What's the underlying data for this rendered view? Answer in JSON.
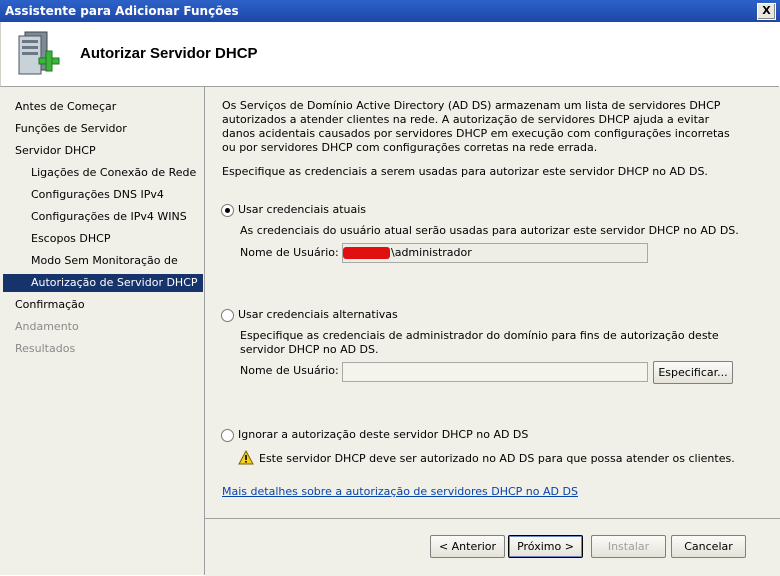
{
  "window": {
    "title": "Assistente para Adicionar Funções",
    "close_glyph": "X"
  },
  "header": {
    "title": "Autorizar Servidor DHCP",
    "icon": "server-add-icon"
  },
  "nav": {
    "items": [
      {
        "label": "Antes de Começar",
        "level": 0,
        "state": "normal"
      },
      {
        "label": "Funções de Servidor",
        "level": 0,
        "state": "normal"
      },
      {
        "label": "Servidor DHCP",
        "level": 0,
        "state": "normal"
      },
      {
        "label": "Ligações de Conexão de Rede",
        "level": 1,
        "state": "normal"
      },
      {
        "label": "Configurações DNS IPv4",
        "level": 1,
        "state": "normal"
      },
      {
        "label": "Configurações de IPv4 WINS",
        "level": 1,
        "state": "normal"
      },
      {
        "label": "Escopos DHCP",
        "level": 1,
        "state": "normal"
      },
      {
        "label": "Modo Sem Monitoração de Est...",
        "level": 1,
        "state": "normal"
      },
      {
        "label": "Autorização de Servidor DHCP",
        "level": 1,
        "state": "active"
      },
      {
        "label": "Confirmação",
        "level": 0,
        "state": "normal"
      },
      {
        "label": "Andamento",
        "level": 0,
        "state": "disabled"
      },
      {
        "label": "Resultados",
        "level": 0,
        "state": "disabled"
      }
    ]
  },
  "main": {
    "intro": "Os Serviços de Domínio Active Directory (AD DS) armazenam um lista de servidores DHCP autorizados a atender clientes na rede. A autorização de servidores DHCP ajuda a evitar danos acidentais causados por servidores DHCP em execução com configurações incorretas ou por servidores DHCP com configurações corretas na rede errada.",
    "instruction": "Especifique as credenciais a serem usadas para autorizar este servidor DHCP no AD DS.",
    "opt_current": {
      "label": "Usar credenciais atuais",
      "desc": "As credenciais do usuário atual serão usadas para autorizar este servidor DHCP no AD DS.",
      "user_label": "Nome de Usuário:",
      "user_value": "\\administrador",
      "selected": true
    },
    "opt_alternate": {
      "label": "Usar credenciais alternativas",
      "desc": "Especifique as credenciais de administrador do domínio para fins de autorização deste servidor DHCP no AD DS.",
      "user_label": "Nome de Usuário:",
      "user_value": "",
      "specify_button": "Especificar..."
    },
    "opt_skip": {
      "label": "Ignorar a autorização deste servidor DHCP no AD DS",
      "warning": "Este servidor DHCP deve ser autorizado no AD DS para que possa atender os clientes."
    },
    "more_link": "Mais detalhes sobre a autorização de servidores DHCP no AD DS"
  },
  "footer": {
    "back": "< Anterior",
    "next": "Próximo >",
    "install": "Instalar",
    "cancel": "Cancelar"
  },
  "colors": {
    "nav_active": "#17336b",
    "panel_bg": "#f0efe8",
    "link": "#0645ad",
    "title_bar": "#2d62c9"
  }
}
